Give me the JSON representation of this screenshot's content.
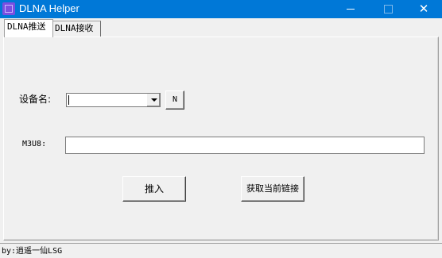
{
  "window": {
    "title": "DLNA Helper",
    "icon": "app-icon",
    "controls": {
      "minimize": "minimize-icon",
      "maximize": "maximize-icon",
      "close": "close-icon",
      "close_glyph": "✕"
    },
    "accent": "#0078d7"
  },
  "tabs": [
    {
      "label": "DLNA推送",
      "active": true
    },
    {
      "label": "DLNA接收",
      "active": false
    }
  ],
  "form": {
    "device_label": "设备名:",
    "device_value": "",
    "n_button": "N",
    "m3u8_label": "M3U8:",
    "m3u8_value": "",
    "push_button": "推入",
    "fetch_button": "获取当前链接"
  },
  "status": {
    "text": "by:逍遥一仙LSG"
  }
}
